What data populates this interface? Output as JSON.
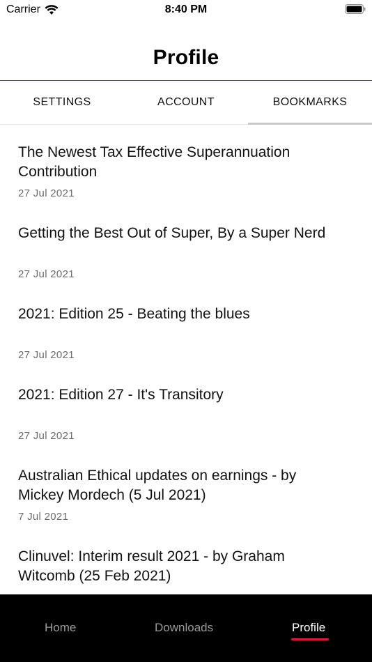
{
  "status_bar": {
    "carrier": "Carrier",
    "time": "8:40 PM"
  },
  "header": {
    "title": "Profile",
    "accent_color": "#c8102e"
  },
  "tabs": [
    {
      "label": "SETTINGS",
      "active": false
    },
    {
      "label": "ACCOUNT",
      "active": false
    },
    {
      "label": "BOOKMARKS",
      "active": true
    }
  ],
  "bookmarks": [
    {
      "title": "The Newest Tax Effective Superannuation Contribution",
      "date": "27 Jul 2021"
    },
    {
      "title": "Getting the Best Out of Super, By a Super Nerd",
      "date": "27 Jul 2021"
    },
    {
      "title": "2021: Edition 25 - Beating the blues",
      "date": "27 Jul 2021"
    },
    {
      "title": "2021: Edition 27 - It's Transitory",
      "date": "27 Jul 2021"
    },
    {
      "title": "Australian Ethical updates on earnings - by Mickey Mordech (5 Jul 2021)",
      "date": "7 Jul 2021"
    },
    {
      "title": "Clinuvel: Interim result 2021 - by Graham Witcomb (25 Feb 2021)",
      "date": ""
    }
  ],
  "bottom_nav": {
    "home": "Home",
    "downloads": "Downloads",
    "profile": "Profile",
    "active_color": "#e0163b"
  },
  "icons": {
    "wifi": "wifi-icon",
    "battery": "battery-icon"
  }
}
